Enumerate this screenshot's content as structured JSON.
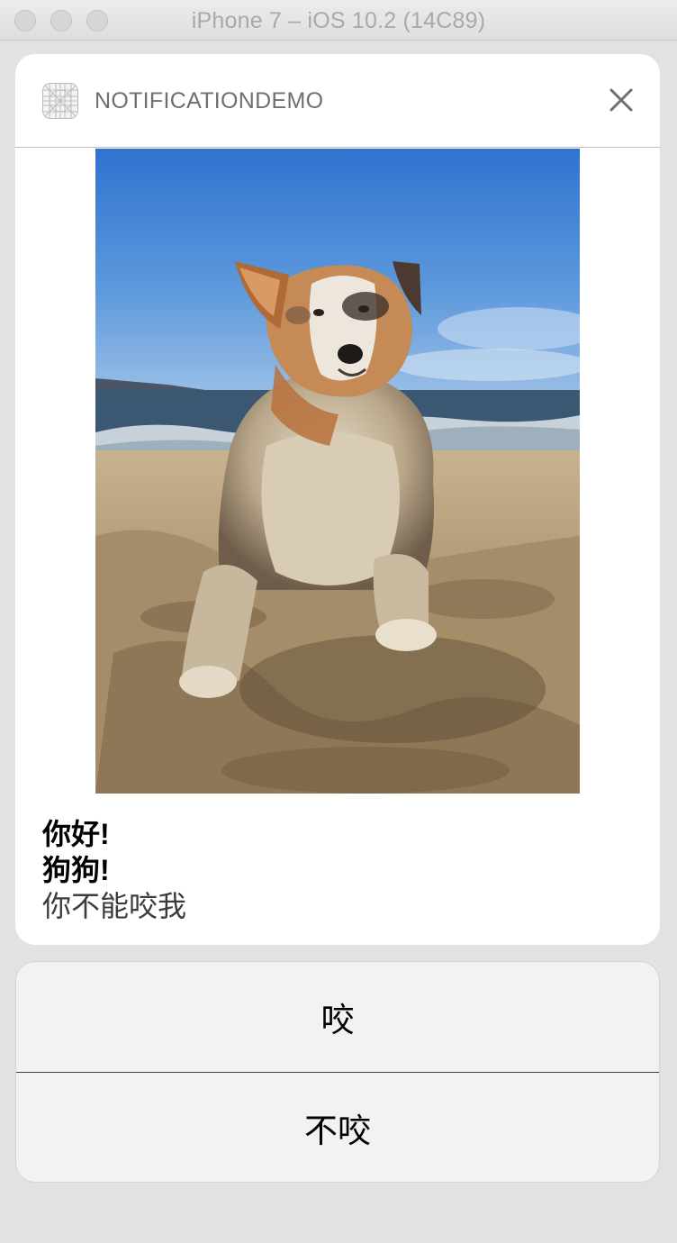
{
  "window": {
    "title": "iPhone 7 – iOS 10.2 (14C89)"
  },
  "notification": {
    "app_name": "NOTIFICATIONDEMO",
    "close_icon": "close-icon",
    "attachment_icon": "dog-on-beach-photo",
    "title": "你好!",
    "subtitle": "狗狗!",
    "body": "你不能咬我"
  },
  "actions": [
    {
      "label": "咬"
    },
    {
      "label": "不咬"
    }
  ],
  "colors": {
    "card_background": "#ffffff",
    "action_background": "#f2f2f2",
    "window_background": "#e2e2e2"
  }
}
